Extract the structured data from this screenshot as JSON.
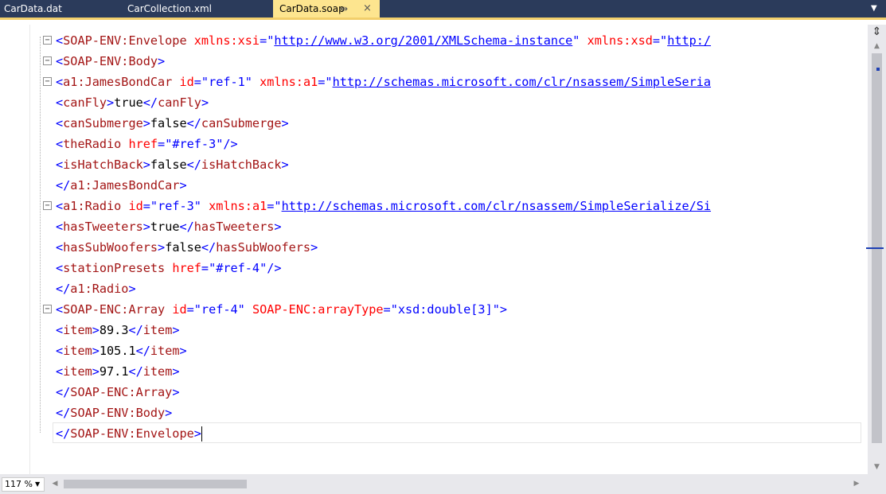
{
  "tabs": [
    {
      "label": "CarData.dat",
      "active": false
    },
    {
      "label": "CarCollection.xml",
      "active": false
    },
    {
      "label": "CarData.soap",
      "active": true
    }
  ],
  "tab_controls": {
    "pin_icon": "pin-icon",
    "close_glyph": "×",
    "dropdown_icon": "chevron-down-icon"
  },
  "colors": {
    "tab_bar": "#2b3b5b",
    "active_tab": "#fde58f",
    "tag": "#a31515",
    "attribute": "#ff0000",
    "value": "#0000ff",
    "markup": "#0000ff"
  },
  "editor": {
    "lines": [
      {
        "fold": "⊟",
        "tokens": [
          {
            "c": "br",
            "t": "<"
          },
          {
            "c": "tag",
            "t": "SOAP-ENV:Envelope"
          },
          {
            "c": "txt",
            "t": " "
          },
          {
            "c": "attr",
            "t": "xmlns:xsi"
          },
          {
            "c": "br",
            "t": "="
          },
          {
            "c": "val",
            "t": "\""
          },
          {
            "c": "url",
            "t": "http://www.w3.org/2001/XMLSchema-instance"
          },
          {
            "c": "val",
            "t": "\""
          },
          {
            "c": "txt",
            "t": " "
          },
          {
            "c": "attr",
            "t": "xmlns:xsd"
          },
          {
            "c": "br",
            "t": "="
          },
          {
            "c": "val",
            "t": "\""
          },
          {
            "c": "url",
            "t": "http:/"
          }
        ]
      },
      {
        "fold": "⊟",
        "tokens": [
          {
            "c": "br",
            "t": "<"
          },
          {
            "c": "tag",
            "t": "SOAP-ENV:Body"
          },
          {
            "c": "br",
            "t": ">"
          }
        ]
      },
      {
        "fold": "⊟",
        "tokens": [
          {
            "c": "br",
            "t": "<"
          },
          {
            "c": "tag",
            "t": "a1:JamesBondCar"
          },
          {
            "c": "txt",
            "t": " "
          },
          {
            "c": "attr",
            "t": "id"
          },
          {
            "c": "br",
            "t": "="
          },
          {
            "c": "val",
            "t": "\"ref-1\""
          },
          {
            "c": "txt",
            "t": " "
          },
          {
            "c": "attr",
            "t": "xmlns:a1"
          },
          {
            "c": "br",
            "t": "="
          },
          {
            "c": "val",
            "t": "\""
          },
          {
            "c": "url",
            "t": "http://schemas.microsoft.com/clr/nsassem/SimpleSeria"
          }
        ]
      },
      {
        "fold": "",
        "tokens": [
          {
            "c": "br",
            "t": "<"
          },
          {
            "c": "tag",
            "t": "canFly"
          },
          {
            "c": "br",
            "t": ">"
          },
          {
            "c": "txt",
            "t": "true"
          },
          {
            "c": "br",
            "t": "</"
          },
          {
            "c": "tag",
            "t": "canFly"
          },
          {
            "c": "br",
            "t": ">"
          }
        ]
      },
      {
        "fold": "",
        "tokens": [
          {
            "c": "br",
            "t": "<"
          },
          {
            "c": "tag",
            "t": "canSubmerge"
          },
          {
            "c": "br",
            "t": ">"
          },
          {
            "c": "txt",
            "t": "false"
          },
          {
            "c": "br",
            "t": "</"
          },
          {
            "c": "tag",
            "t": "canSubmerge"
          },
          {
            "c": "br",
            "t": ">"
          }
        ]
      },
      {
        "fold": "",
        "tokens": [
          {
            "c": "br",
            "t": "<"
          },
          {
            "c": "tag",
            "t": "theRadio"
          },
          {
            "c": "txt",
            "t": " "
          },
          {
            "c": "attr",
            "t": "href"
          },
          {
            "c": "br",
            "t": "="
          },
          {
            "c": "val",
            "t": "\"#ref-3\""
          },
          {
            "c": "br",
            "t": "/>"
          }
        ]
      },
      {
        "fold": "",
        "tokens": [
          {
            "c": "br",
            "t": "<"
          },
          {
            "c": "tag",
            "t": "isHatchBack"
          },
          {
            "c": "br",
            "t": ">"
          },
          {
            "c": "txt",
            "t": "false"
          },
          {
            "c": "br",
            "t": "</"
          },
          {
            "c": "tag",
            "t": "isHatchBack"
          },
          {
            "c": "br",
            "t": ">"
          }
        ]
      },
      {
        "fold": "",
        "tokens": [
          {
            "c": "br",
            "t": "</"
          },
          {
            "c": "tag",
            "t": "a1:JamesBondCar"
          },
          {
            "c": "br",
            "t": ">"
          }
        ]
      },
      {
        "fold": "⊟",
        "tokens": [
          {
            "c": "br",
            "t": "<"
          },
          {
            "c": "tag",
            "t": "a1:Radio"
          },
          {
            "c": "txt",
            "t": " "
          },
          {
            "c": "attr",
            "t": "id"
          },
          {
            "c": "br",
            "t": "="
          },
          {
            "c": "val",
            "t": "\"ref-3\""
          },
          {
            "c": "txt",
            "t": " "
          },
          {
            "c": "attr",
            "t": "xmlns:a1"
          },
          {
            "c": "br",
            "t": "="
          },
          {
            "c": "val",
            "t": "\""
          },
          {
            "c": "url",
            "t": "http://schemas.microsoft.com/clr/nsassem/SimpleSerialize/Si"
          }
        ]
      },
      {
        "fold": "",
        "tokens": [
          {
            "c": "br",
            "t": "<"
          },
          {
            "c": "tag",
            "t": "hasTweeters"
          },
          {
            "c": "br",
            "t": ">"
          },
          {
            "c": "txt",
            "t": "true"
          },
          {
            "c": "br",
            "t": "</"
          },
          {
            "c": "tag",
            "t": "hasTweeters"
          },
          {
            "c": "br",
            "t": ">"
          }
        ]
      },
      {
        "fold": "",
        "tokens": [
          {
            "c": "br",
            "t": "<"
          },
          {
            "c": "tag",
            "t": "hasSubWoofers"
          },
          {
            "c": "br",
            "t": ">"
          },
          {
            "c": "txt",
            "t": "false"
          },
          {
            "c": "br",
            "t": "</"
          },
          {
            "c": "tag",
            "t": "hasSubWoofers"
          },
          {
            "c": "br",
            "t": ">"
          }
        ]
      },
      {
        "fold": "",
        "tokens": [
          {
            "c": "br",
            "t": "<"
          },
          {
            "c": "tag",
            "t": "stationPresets"
          },
          {
            "c": "txt",
            "t": " "
          },
          {
            "c": "attr",
            "t": "href"
          },
          {
            "c": "br",
            "t": "="
          },
          {
            "c": "val",
            "t": "\"#ref-4\""
          },
          {
            "c": "br",
            "t": "/>"
          }
        ]
      },
      {
        "fold": "",
        "tokens": [
          {
            "c": "br",
            "t": "</"
          },
          {
            "c": "tag",
            "t": "a1:Radio"
          },
          {
            "c": "br",
            "t": ">"
          }
        ]
      },
      {
        "fold": "⊟",
        "tokens": [
          {
            "c": "br",
            "t": "<"
          },
          {
            "c": "tag",
            "t": "SOAP-ENC:Array"
          },
          {
            "c": "txt",
            "t": " "
          },
          {
            "c": "attr",
            "t": "id"
          },
          {
            "c": "br",
            "t": "="
          },
          {
            "c": "val",
            "t": "\"ref-4\""
          },
          {
            "c": "txt",
            "t": " "
          },
          {
            "c": "attr",
            "t": "SOAP-ENC:arrayType"
          },
          {
            "c": "br",
            "t": "="
          },
          {
            "c": "val",
            "t": "\"xsd:double[3]\""
          },
          {
            "c": "br",
            "t": ">"
          }
        ]
      },
      {
        "fold": "",
        "tokens": [
          {
            "c": "br",
            "t": "<"
          },
          {
            "c": "tag",
            "t": "item"
          },
          {
            "c": "br",
            "t": ">"
          },
          {
            "c": "txt",
            "t": "89.3"
          },
          {
            "c": "br",
            "t": "</"
          },
          {
            "c": "tag",
            "t": "item"
          },
          {
            "c": "br",
            "t": ">"
          }
        ]
      },
      {
        "fold": "",
        "tokens": [
          {
            "c": "br",
            "t": "<"
          },
          {
            "c": "tag",
            "t": "item"
          },
          {
            "c": "br",
            "t": ">"
          },
          {
            "c": "txt",
            "t": "105.1"
          },
          {
            "c": "br",
            "t": "</"
          },
          {
            "c": "tag",
            "t": "item"
          },
          {
            "c": "br",
            "t": ">"
          }
        ]
      },
      {
        "fold": "",
        "tokens": [
          {
            "c": "br",
            "t": "<"
          },
          {
            "c": "tag",
            "t": "item"
          },
          {
            "c": "br",
            "t": ">"
          },
          {
            "c": "txt",
            "t": "97.1"
          },
          {
            "c": "br",
            "t": "</"
          },
          {
            "c": "tag",
            "t": "item"
          },
          {
            "c": "br",
            "t": ">"
          }
        ]
      },
      {
        "fold": "",
        "tokens": [
          {
            "c": "br",
            "t": "</"
          },
          {
            "c": "tag",
            "t": "SOAP-ENC:Array"
          },
          {
            "c": "br",
            "t": ">"
          }
        ]
      },
      {
        "fold": "",
        "tokens": [
          {
            "c": "br",
            "t": "</"
          },
          {
            "c": "tag",
            "t": "SOAP-ENV:Body"
          },
          {
            "c": "br",
            "t": ">"
          }
        ]
      },
      {
        "fold": "",
        "tokens": [
          {
            "c": "br",
            "t": "</"
          },
          {
            "c": "tag",
            "t": "SOAP-ENV:Envelope"
          },
          {
            "c": "br",
            "t": ">"
          }
        ]
      }
    ]
  },
  "scrollbar": {
    "split_icon": "split-icon",
    "up_icon": "scroll-up-icon",
    "down_icon": "scroll-down-icon",
    "left_icon": "scroll-left-icon",
    "right_icon": "scroll-right-icon"
  },
  "status": {
    "zoom": "117 %"
  }
}
